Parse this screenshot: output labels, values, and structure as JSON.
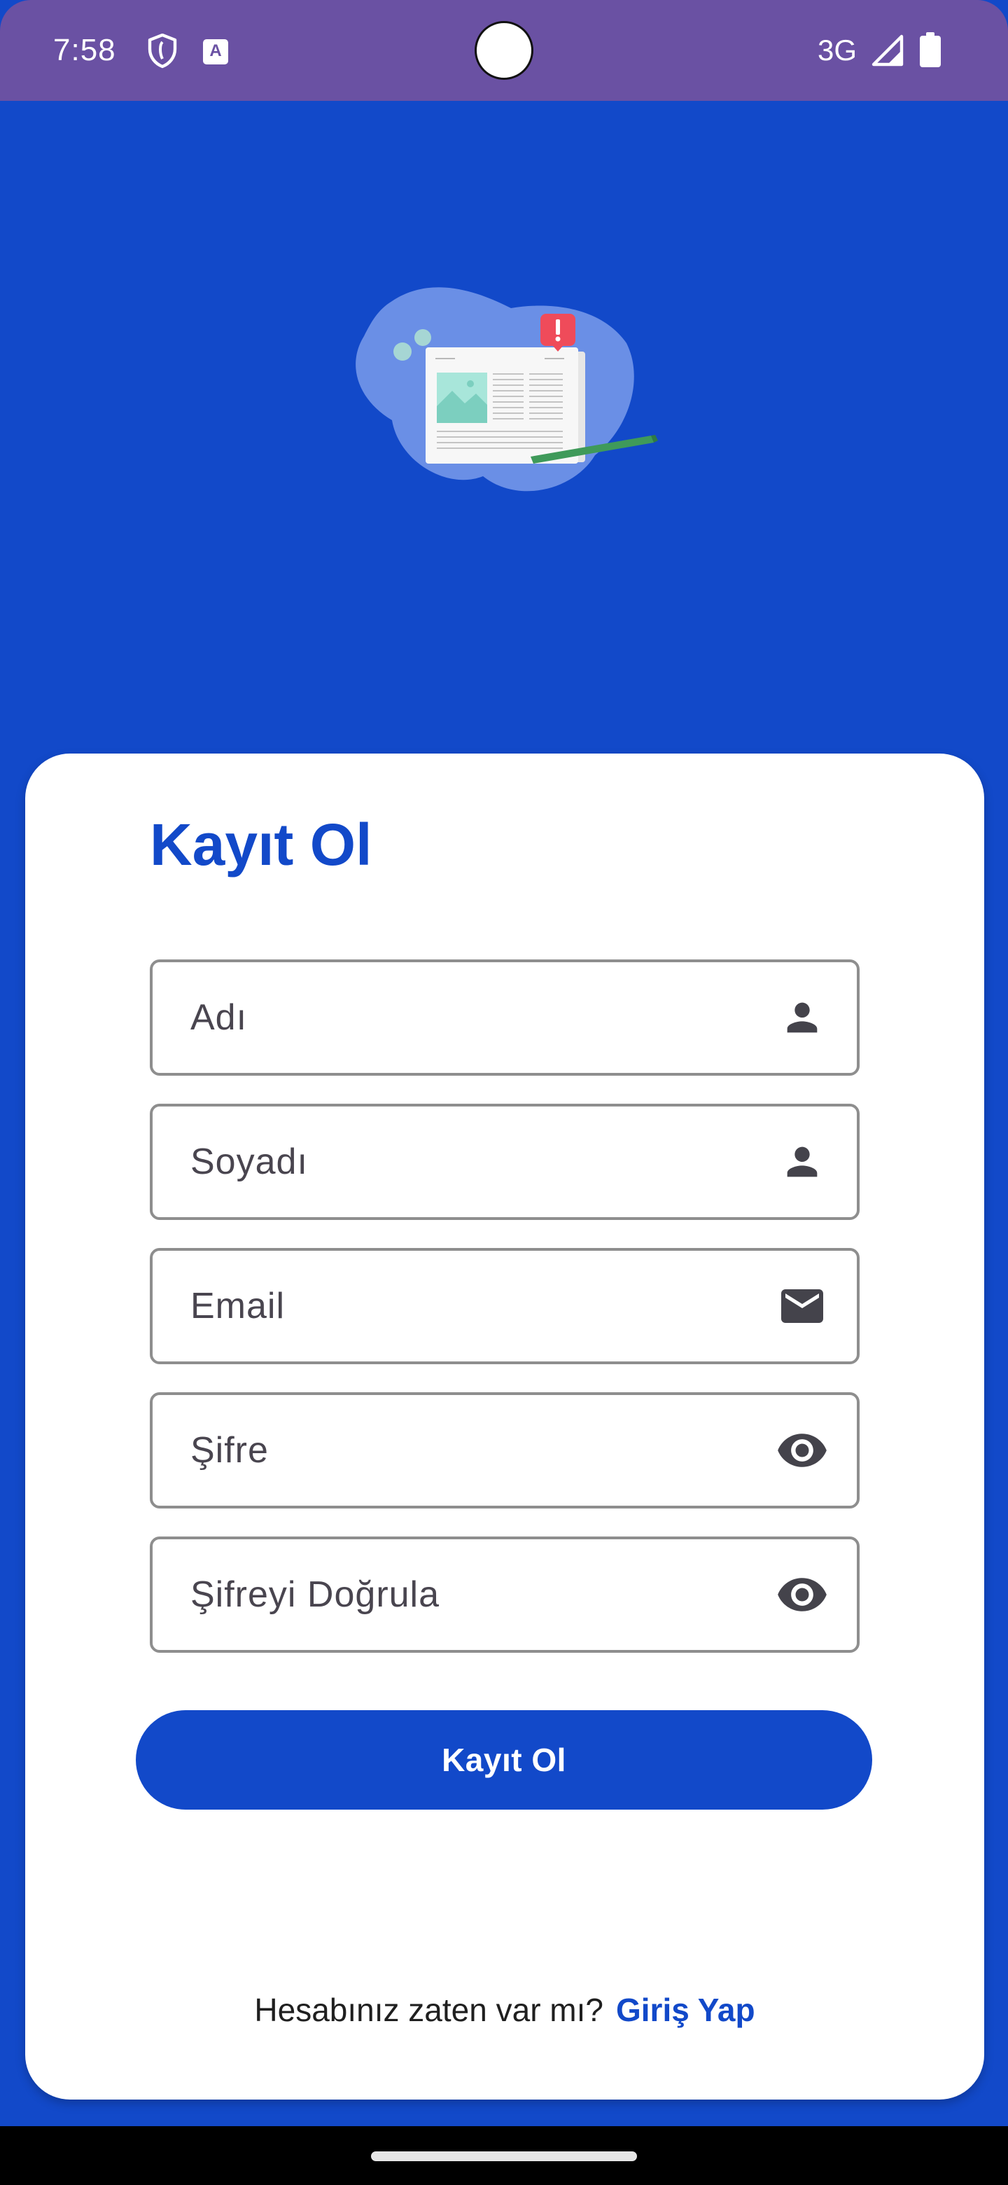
{
  "status_bar": {
    "time": "7:58",
    "network": "3G",
    "a_badge": "A",
    "icons": [
      "shield-icon",
      "text-badge-icon",
      "signal-icon",
      "battery-icon"
    ],
    "background_color": "#6a51a3"
  },
  "hero": {
    "icon": "newspaper-illustration-icon"
  },
  "form": {
    "title": "Kayıt Ol",
    "fields": [
      {
        "label": "Adı",
        "icon": "person-icon"
      },
      {
        "label": "Soyadı",
        "icon": "person-icon"
      },
      {
        "label": "Email",
        "icon": "email-icon"
      },
      {
        "label": "Şifre",
        "icon": "eye-icon"
      },
      {
        "label": "Şifreyi Doğrula",
        "icon": "eye-icon"
      }
    ],
    "submit_label": "Kayıt Ol"
  },
  "footer": {
    "question": "Hesabınız zaten var mı?",
    "link": "Giriş Yap"
  },
  "colors": {
    "primary": "#1249c9",
    "card": "#ffffff",
    "field_border": "#8e8e8e",
    "field_text": "#49454f"
  }
}
